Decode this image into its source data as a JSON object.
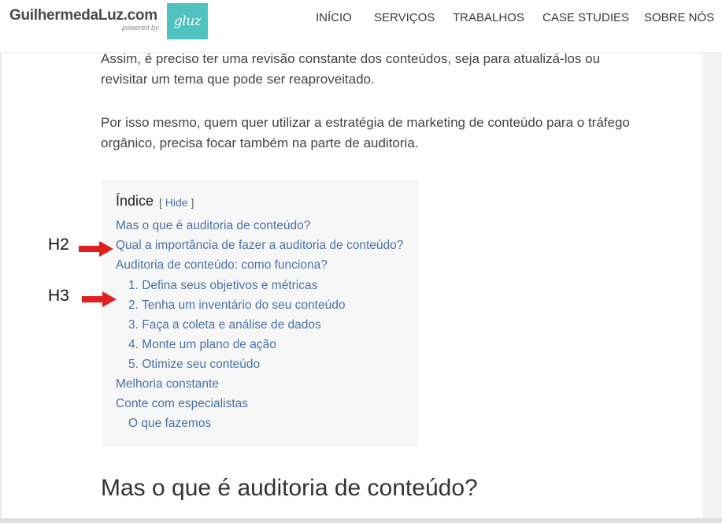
{
  "header": {
    "brand_name": "GuilhermedaLuz.com",
    "brand_powered": "powered by",
    "logo_text": "gluz",
    "nav": [
      "Início",
      "Serviços",
      "Trabalhos",
      "Case Studies",
      "Sobre Nós"
    ]
  },
  "content": {
    "paragraph_1": "Assim, é preciso ter uma revisão constante dos conteúdos, seja para atualizá-los ou revisitar um tema que pode ser reaproveitado.",
    "paragraph_2": "Por isso mesmo, quem quer utilizar a estratégia de marketing de conteúdo para o tráfego orgânico, precisa focar também na parte de auditoria.",
    "heading": "Mas o que é auditoria de conteúdo?"
  },
  "toc": {
    "title": "Índice",
    "hide_open": "[",
    "hide_label": "Hide",
    "hide_close": "]",
    "items": [
      "Mas o que é auditoria de conteúdo?",
      "Qual a importância de fazer a auditoria de conteúdo?",
      "Auditoria de conteúdo: como funciona?",
      "1. Defina seus objetivos e métricas",
      "2. Tenha um inventário do seu conteúdo",
      "3. Faça a coleta e análise de dados",
      "4. Monte um plano de ação",
      "5. Otimize seu conteúdo",
      "Melhoria constante",
      "Conte com especialistas",
      "O que fazemos"
    ]
  },
  "annotations": {
    "h2_label": "H2",
    "h3_label": "H3",
    "arrow_color": "#e02020"
  }
}
